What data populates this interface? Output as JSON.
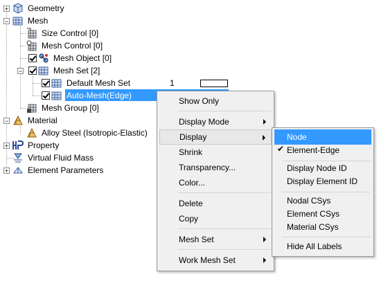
{
  "tree": {
    "geometry": "Geometry",
    "mesh": "Mesh",
    "size_control": "Size Control [0]",
    "mesh_control": "Mesh Control [0]",
    "mesh_object": "Mesh Object [0]",
    "mesh_set": "Mesh Set [2]",
    "default_mesh_set": "Default Mesh Set",
    "default_mesh_set_count": "1",
    "auto_mesh": "Auto-Mesh(Edge)",
    "mesh_group": "Mesh Group [0]",
    "material": "Material",
    "alloy_steel": "Alloy Steel (Isotropic-Elastic)",
    "property": "Property",
    "virtual_fluid_mass": "Virtual Fluid Mass",
    "element_parameters": "Element Parameters"
  },
  "context_menu": {
    "show_only": "Show Only",
    "display_mode": "Display Mode",
    "display": "Display",
    "shrink": "Shrink",
    "transparency": "Transparency...",
    "color": "Color...",
    "delete": "Delete",
    "copy": "Copy",
    "mesh_set": "Mesh Set",
    "work_mesh_set": "Work Mesh Set"
  },
  "display_submenu": {
    "node": "Node",
    "element_edge": "Element-Edge",
    "display_node_id": "Display Node ID",
    "display_element_id": "Display Element ID",
    "nodal_csys": "Nodal CSys",
    "element_csys": "Element CSys",
    "material_csys": "Material CSys",
    "hide_all_labels": "Hide All Labels"
  },
  "colors": {
    "selection": "#3399ff",
    "menu_bg": "#f0f0f0"
  }
}
